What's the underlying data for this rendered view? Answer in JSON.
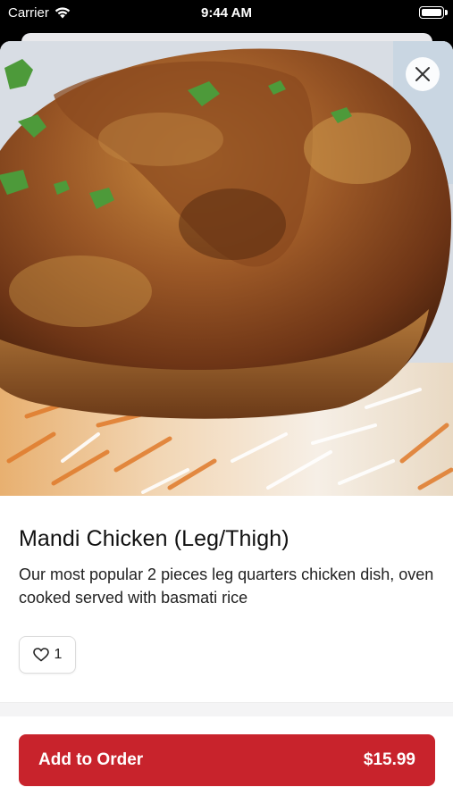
{
  "status_bar": {
    "carrier": "Carrier",
    "time": "9:44 AM"
  },
  "item": {
    "title": "Mandi Chicken (Leg/Thigh)",
    "description": "Our most popular 2 pieces leg quarters chicken dish, oven cooked served with basmati rice",
    "like_count": "1"
  },
  "footer": {
    "add_label": "Add to Order",
    "price": "$15.99"
  },
  "colors": {
    "accent": "#c8232c"
  },
  "icons": {
    "close": "close-icon",
    "like": "heart-icon",
    "wifi": "wifi-icon",
    "battery": "battery-icon"
  }
}
